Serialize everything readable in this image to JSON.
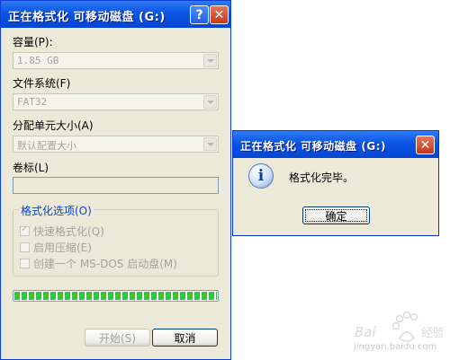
{
  "format_dialog": {
    "title": "正在格式化 可移动磁盘 (G:)",
    "help_button": "?",
    "close_button": "✕",
    "capacity": {
      "label": "容量(P):",
      "value": "1.85 GB"
    },
    "file_system": {
      "label": "文件系统(F)",
      "value": "FAT32"
    },
    "allocation": {
      "label": "分配单元大小(A)",
      "value": "默认配置大小"
    },
    "volume_label": {
      "label": "卷标(L)",
      "value": ""
    },
    "options": {
      "title": "格式化选项(O)",
      "quick_format": {
        "label": "快速格式化(Q)",
        "checked": true
      },
      "compression": {
        "label": "启用压缩(E)",
        "checked": false
      },
      "msdos_boot": {
        "label": "创建一个 MS-DOS 启动盘(M)",
        "checked": false
      }
    },
    "progress": 1.0,
    "start_button": "开始(S)",
    "cancel_button": "取消"
  },
  "message_box": {
    "title": "正在格式化 可移动磁盘 (G:)",
    "close_button": "✕",
    "icon": "info-icon",
    "message": "格式化完毕。",
    "ok_button": "确定"
  },
  "watermark": {
    "logo": "Baidu 经验",
    "url": "jingyan.baidu.com"
  },
  "colors": {
    "title_bar": "#0a55e4",
    "window_bg": "#ece9d8",
    "progress_fill": "#37c53d",
    "group_title": "#0046d5"
  }
}
